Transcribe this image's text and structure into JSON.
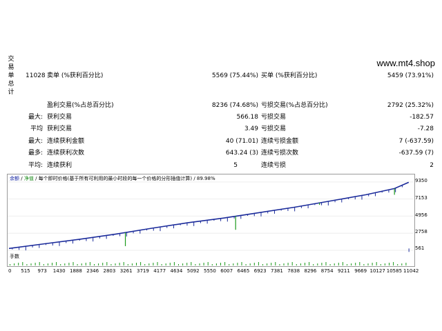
{
  "side_label": [
    "交",
    "易",
    "单",
    "总",
    "计"
  ],
  "site": "www.mt4.shop",
  "stats": {
    "row1": {
      "total": "11028",
      "sell_label": "卖单 (%获利百分比)",
      "sell_value": "5569 (75.44%)",
      "buy_label": "买单 (%获利百分比)",
      "buy_value": "5459 (73.91%)"
    },
    "row2": {
      "label": "盈利交易(%占总百分比)",
      "value": "8236 (74.68%)",
      "label2": "亏损交易(%占总百分比)",
      "value2": "2792 (25.32%)"
    },
    "row3": {
      "prefix": "最大:",
      "label": "获利交易",
      "value": "566.18",
      "label2": "亏损交易",
      "value2": "-182.57"
    },
    "row4": {
      "prefix": "平均",
      "label": "获利交易",
      "value": "3.49",
      "label2": "亏损交易",
      "value2": "-7.28"
    },
    "row5": {
      "prefix": "最大:",
      "label": "连续获利金额",
      "value": "40 (71.01)",
      "label2": "连续亏损金额",
      "value2": "7 (-637.59)"
    },
    "row6": {
      "prefix": "最多:",
      "label": "连续获利次数",
      "value": "643.24 (3)",
      "label2": "连续亏损次数",
      "value2": "-637.59 (7)"
    },
    "row7": {
      "prefix": "平均:",
      "label": "连续获利",
      "value": "5",
      "label2": "连续亏损",
      "value2": "2"
    }
  },
  "chart": {
    "title_balance": "余额",
    "title_equity": "净值",
    "title_rest": "/ 每个即时价格(基于所有可利用的最小时段的每一个价格的分形插值计算) / 89.98%",
    "volume_label": "手数",
    "line_color": "#1a2a9a",
    "equity_color": "#1a9a1a"
  },
  "chart_data": {
    "type": "line",
    "y_ticks": [
      "9350",
      "7153",
      "4956",
      "2758",
      "561"
    ],
    "y_tick_values": [
      9350,
      7153,
      4956,
      2758,
      561
    ],
    "x_ticks": [
      "0",
      "515",
      "973",
      "1430",
      "1888",
      "2346",
      "2803",
      "3261",
      "3719",
      "4177",
      "4634",
      "5092",
      "5550",
      "6007",
      "6465",
      "6923",
      "7381",
      "7838",
      "8296",
      "8754",
      "9211",
      "9669",
      "10127",
      "10585",
      "11042"
    ],
    "ylim": [
      561,
      9600
    ],
    "xlim": [
      0,
      11300
    ],
    "series": [
      {
        "values_x": [
          0,
          1000,
          2000,
          3000,
          4000,
          5000,
          6000,
          7000,
          8000,
          9000,
          10000,
          10800,
          11200
        ],
        "values_y": [
          800,
          1400,
          2000,
          2650,
          3400,
          4100,
          4700,
          5400,
          6100,
          6900,
          7700,
          8500,
          9300
        ]
      }
    ],
    "dips": [
      {
        "x": 3261,
        "y": 1100
      },
      {
        "x": 6350,
        "y": 3200
      },
      {
        "x": 8700,
        "y": 6400
      },
      {
        "x": 10800,
        "y": 7700
      }
    ]
  }
}
